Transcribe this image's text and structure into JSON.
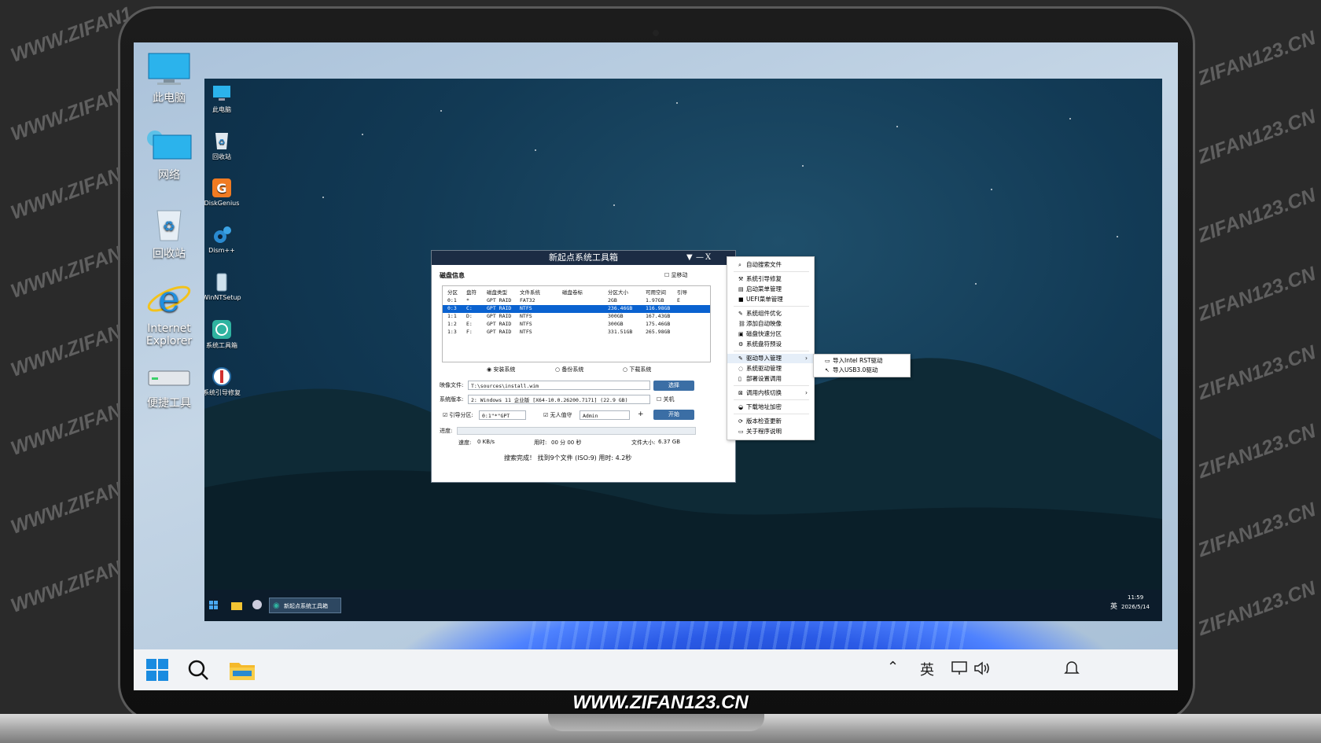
{
  "watermark": "WWW.ZIFAN123.CN",
  "watermark_left": "WWW.ZIFAN1",
  "watermark_right": "ZIFAN123.CN",
  "bottom_watermark": "WWW.ZIFAN123.CN",
  "desktop_icons": [
    "此电脑",
    "网络",
    "回收站",
    "Internet Explorer",
    "便捷工具"
  ],
  "pe_desktop_icons": [
    "此电脑",
    "回收站",
    "DiskGenius",
    "Dism++",
    "WinNTSetup",
    "系统工具箱",
    "系统引导修复"
  ],
  "pe_taskbar": {
    "task_label": "新起点系统工具箱",
    "ime": "英",
    "time": "11:59",
    "date": "2026/5/14"
  },
  "win11_taskbar": {
    "ime": "英"
  },
  "tool_window": {
    "title": "新起点系统工具箱",
    "ctrl_menu": "▼",
    "ctrl_min": "—",
    "ctrl_close": "X",
    "disk_group": "磁盘信息",
    "show_mobile": "显移动",
    "columns": [
      "分区",
      "盘符",
      "磁盘类型",
      "文件系统",
      "磁盘卷标",
      "分区大小",
      "可用空间",
      "引导"
    ],
    "rows": [
      [
        "0:1",
        "*",
        "GPT RAID",
        "FAT32",
        "",
        "2GB",
        "1.97GB",
        "E"
      ],
      [
        "0:3",
        "C:",
        "GPT RAID",
        "NTFS",
        "",
        "236.46GB",
        "116.98GB",
        ""
      ],
      [
        "1:1",
        "D:",
        "GPT RAID",
        "NTFS",
        "",
        "300GB",
        "167.43GB",
        ""
      ],
      [
        "1:2",
        "E:",
        "GPT RAID",
        "NTFS",
        "",
        "300GB",
        "175.46GB",
        ""
      ],
      [
        "1:3",
        "F:",
        "GPT RAID",
        "NTFS",
        "",
        "331.51GB",
        "265.98GB",
        ""
      ]
    ],
    "selected_row": 1,
    "modes": [
      "安装系统",
      "备份系统",
      "下载系统"
    ],
    "image_label": "映像文件:",
    "image_value": "T:\\sources\\install.wim",
    "browse_button": "选择",
    "version_label": "系统版本:",
    "version_value": "2: Windows 11 企业版 [X64-10.0.26200.7171] (22.9 GB)",
    "shutdown_label": "关机",
    "boot_label": "引导分区:",
    "boot_value": "0:1\"*\"GPT",
    "unattend_label": "无人值守",
    "admin_value": "Admin",
    "plus": "+",
    "start_button": "开始",
    "progress_label": "进度:",
    "speed_label": "速度:",
    "speed_value": "0 KB/s",
    "time_label": "用时:",
    "time_value": "00  分  00  秒",
    "filesize_label": "文件大小:",
    "filesize_value": "6.37 GB",
    "status": "搜索完成！ 找到9个文件 (ISO:9) 用时: 4.2秒"
  },
  "context_menu": {
    "items": [
      "自动搜索文件",
      "系统引导修复",
      "启动菜单管理",
      "UEFI菜单管理",
      "系统组件优化",
      "添加自动映像",
      "磁盘快速分区",
      "系统盘符预设",
      "驱动导入管理",
      "系统驱动管理",
      "部署设置调用",
      "调用内核切换",
      "下载地址加密",
      "版本检查更新",
      "关于程序说明"
    ],
    "arrow": "›",
    "submenu": [
      "导入Intel RST驱动",
      "导入USB3.0驱动"
    ]
  }
}
